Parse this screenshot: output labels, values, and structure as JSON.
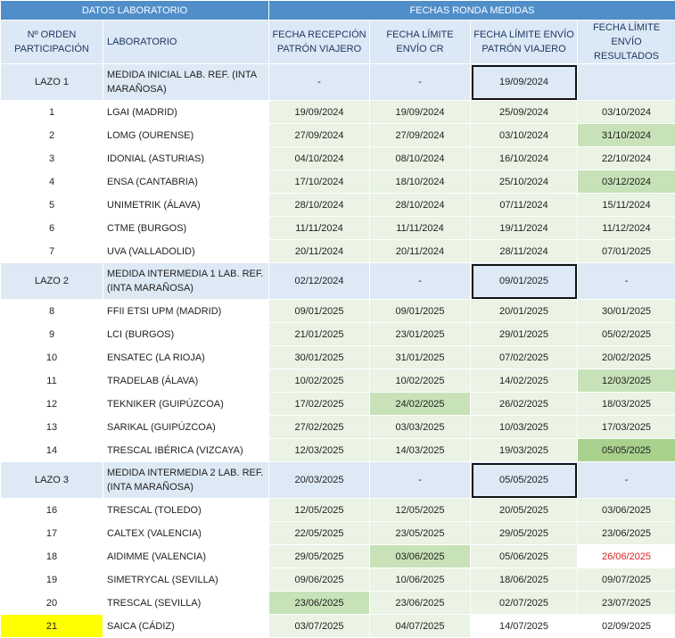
{
  "header": {
    "group_left": "DATOS LABORATORIO",
    "group_right": "FECHAS RONDA MEDIDAS",
    "col_order": "Nº ORDEN PARTICIPACIÓN",
    "col_lab": "LABORATORIO",
    "col_recepcion": "FECHA RECEPCIÓN PATRÓN VIAJERO",
    "col_envio_cr": "FECHA LÍMITE ENVÍO CR",
    "col_envio_patron": "FECHA LÍMITE ENVÍO PATRÓN VIAJERO",
    "col_envio_resultados": "FECHA LÍMITE ENVÍO RESULTADOS"
  },
  "rows": [
    {
      "type": "lazo",
      "order": "LAZO 1",
      "lab": "MEDIDA INICIAL LAB. REF. (INTA MARAÑOSA)",
      "recepcion": "-",
      "envio_cr": "-",
      "envio_patron": "19/09/2024",
      "envio_resultados": ""
    },
    {
      "type": "row",
      "order": "1",
      "lab": "LGAI (MADRID)",
      "recepcion": "19/09/2024",
      "envio_cr": "19/09/2024",
      "envio_patron": "25/09/2024",
      "envio_resultados": "03/10/2024",
      "shade": [
        "d",
        "d",
        "d",
        "d"
      ]
    },
    {
      "type": "row",
      "order": "2",
      "lab": "LOMG (OURENSE)",
      "recepcion": "27/09/2024",
      "envio_cr": "27/09/2024",
      "envio_patron": "03/10/2024",
      "envio_resultados": "31/10/2024",
      "shade": [
        "d",
        "d",
        "d",
        "g"
      ]
    },
    {
      "type": "row",
      "order": "3",
      "lab": "IDONIAL (ASTURIAS)",
      "recepcion": "04/10/2024",
      "envio_cr": "08/10/2024",
      "envio_patron": "16/10/2024",
      "envio_resultados": "22/10/2024",
      "shade": [
        "d",
        "d",
        "d",
        "d"
      ]
    },
    {
      "type": "row",
      "order": "4",
      "lab": "ENSA (CANTABRIA)",
      "recepcion": "17/10/2024",
      "envio_cr": "18/10/2024",
      "envio_patron": "25/10/2024",
      "envio_resultados": "03/12/2024",
      "shade": [
        "d",
        "d",
        "d",
        "g"
      ]
    },
    {
      "type": "row",
      "order": "5",
      "lab": "UNIMETRIK (ÁLAVA)",
      "recepcion": "28/10/2024",
      "envio_cr": "28/10/2024",
      "envio_patron": "07/11/2024",
      "envio_resultados": "15/11/2024",
      "shade": [
        "d",
        "d",
        "d",
        "d"
      ]
    },
    {
      "type": "row",
      "order": "6",
      "lab": "CTME (BURGOS)",
      "recepcion": "11/11/2024",
      "envio_cr": "11/11/2024",
      "envio_patron": "19/11/2024",
      "envio_resultados": "11/12/2024",
      "shade": [
        "d",
        "d",
        "d",
        "d"
      ]
    },
    {
      "type": "row",
      "order": "7",
      "lab": "UVA (VALLADOLID)",
      "recepcion": "20/11/2024",
      "envio_cr": "20/11/2024",
      "envio_patron": "28/11/2024",
      "envio_resultados": "07/01/2025",
      "shade": [
        "d",
        "d",
        "d",
        "d"
      ]
    },
    {
      "type": "lazo",
      "order": "LAZO 2",
      "lab": "MEDIDA INTERMEDIA 1 LAB. REF. (INTA MARAÑOSA)",
      "recepcion": "02/12/2024",
      "envio_cr": "-",
      "envio_patron": "09/01/2025",
      "envio_resultados": "-"
    },
    {
      "type": "row",
      "order": "8",
      "lab": "FFII ETSI UPM (MADRID)",
      "recepcion": "09/01/2025",
      "envio_cr": "09/01/2025",
      "envio_patron": "20/01/2025",
      "envio_resultados": "30/01/2025",
      "shade": [
        "d",
        "d",
        "d",
        "d"
      ]
    },
    {
      "type": "row",
      "order": "9",
      "lab": "LCI (BURGOS)",
      "recepcion": "21/01/2025",
      "envio_cr": "23/01/2025",
      "envio_patron": "29/01/2025",
      "envio_resultados": "05/02/2025",
      "shade": [
        "d",
        "d",
        "d",
        "d"
      ]
    },
    {
      "type": "row",
      "order": "10",
      "lab": "ENSATEC (LA RIOJA)",
      "recepcion": "30/01/2025",
      "envio_cr": "31/01/2025",
      "envio_patron": "07/02/2025",
      "envio_resultados": "20/02/2025",
      "shade": [
        "d",
        "d",
        "d",
        "d"
      ]
    },
    {
      "type": "row",
      "order": "11",
      "lab": "TRADELAB (ÁLAVA)",
      "recepcion": "10/02/2025",
      "envio_cr": "10/02/2025",
      "envio_patron": "14/02/2025",
      "envio_resultados": "12/03/2025",
      "shade": [
        "d",
        "d",
        "d",
        "g"
      ]
    },
    {
      "type": "row",
      "order": "12",
      "lab": "TEKNIKER (GUIPÚZCOA)",
      "recepcion": "17/02/2025",
      "envio_cr": "24/02/2025",
      "envio_patron": "26/02/2025",
      "envio_resultados": "18/03/2025",
      "shade": [
        "d",
        "g",
        "d",
        "d"
      ]
    },
    {
      "type": "row",
      "order": "13",
      "lab": "SARIKAL (GUIPÚZCOA)",
      "recepcion": "27/02/2025",
      "envio_cr": "03/03/2025",
      "envio_patron": "10/03/2025",
      "envio_resultados": "17/03/2025",
      "shade": [
        "d",
        "d",
        "d",
        "d"
      ]
    },
    {
      "type": "row",
      "order": "14",
      "lab": "TRESCAL IBÉRICA (VIZCAYA)",
      "recepcion": "12/03/2025",
      "envio_cr": "14/03/2025",
      "envio_patron": "19/03/2025",
      "envio_resultados": "05/05/2025",
      "shade": [
        "d",
        "d",
        "d",
        "gg"
      ]
    },
    {
      "type": "lazo",
      "order": "LAZO 3",
      "lab": "MEDIDA INTERMEDIA 2 LAB. REF. (INTA MARAÑOSA)",
      "recepcion": "20/03/2025",
      "envio_cr": "-",
      "envio_patron": "05/05/2025",
      "envio_resultados": "-"
    },
    {
      "type": "row",
      "order": "16",
      "lab": "TRESCAL (TOLEDO)",
      "recepcion": "12/05/2025",
      "envio_cr": "12/05/2025",
      "envio_patron": "20/05/2025",
      "envio_resultados": "03/06/2025",
      "shade": [
        "d",
        "d",
        "d",
        "d"
      ]
    },
    {
      "type": "row",
      "order": "17",
      "lab": "CALTEX (VALENCIA)",
      "recepcion": "22/05/2025",
      "envio_cr": "23/05/2025",
      "envio_patron": "29/05/2025",
      "envio_resultados": "23/06/2025",
      "shade": [
        "d",
        "d",
        "d",
        "d"
      ]
    },
    {
      "type": "row",
      "order": "18",
      "lab": "AIDIMME (VALENCIA)",
      "recepcion": "29/05/2025",
      "envio_cr": "03/06/2025",
      "envio_patron": "05/06/2025",
      "envio_resultados": "26/06/2025",
      "shade": [
        "d",
        "g",
        "d",
        "red"
      ]
    },
    {
      "type": "row",
      "order": "19",
      "lab": "SIMETRYCAL (SEVILLA)",
      "recepcion": "09/06/2025",
      "envio_cr": "10/06/2025",
      "envio_patron": "18/06/2025",
      "envio_resultados": "09/07/2025",
      "shade": [
        "d",
        "d",
        "d",
        "d"
      ]
    },
    {
      "type": "row",
      "order": "20",
      "lab": "TRESCAL (SEVILLA)",
      "recepcion": "23/06/2025",
      "envio_cr": "23/06/2025",
      "envio_patron": "02/07/2025",
      "envio_resultados": "23/07/2025",
      "shade": [
        "g",
        "d",
        "d",
        "d"
      ]
    },
    {
      "type": "row",
      "order": "21",
      "lab": "SAICA (CÁDIZ)",
      "recepcion": "03/07/2025",
      "envio_cr": "04/07/2025",
      "envio_patron": "14/07/2025",
      "envio_resultados": "02/09/2025",
      "shade": [
        "d",
        "d",
        "w",
        "w"
      ],
      "order_highlight": "yellow"
    }
  ],
  "colors": {
    "header_blue": "#4f8ec9",
    "header_light": "#dbe8f5",
    "lazo_fill": "#dde9f5",
    "date_fill": "#eaf3e4",
    "date_fill_mid": "#c7e2b8",
    "date_fill_strong": "#a9d18e",
    "warning_text": "#e02020",
    "highlight_yellow": "#ffff00"
  }
}
